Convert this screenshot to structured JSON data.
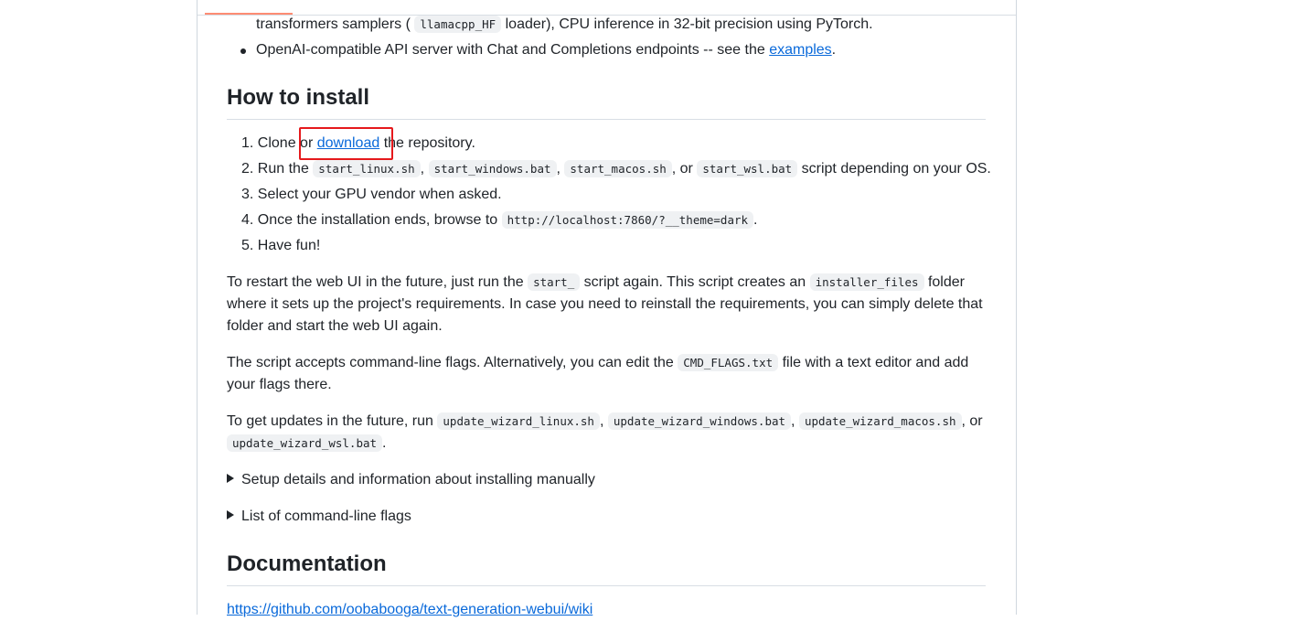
{
  "readme": {
    "features_tail": {
      "line1_a": "transformers samplers (",
      "line1_code": "llamacpp_HF",
      "line1_b": "loader), CPU inference in 32-bit precision using PyTorch.",
      "bullet_a": "OpenAI-compatible API server with Chat and Completions endpoints -- see the",
      "bullet_link": "examples",
      "bullet_b": "."
    },
    "install": {
      "heading": "How to install",
      "steps": [
        {
          "num": "1.",
          "a": "Clone or",
          "link": "download",
          "b": "the repository."
        },
        {
          "num": "2.",
          "a": "Run the",
          "code1": "start_linux.sh",
          "sep1": ",",
          "code2": "start_windows.bat",
          "sep2": ",",
          "code3": "start_macos.sh",
          "sep3": ", or",
          "code4": "start_wsl.bat",
          "b": "script depending on your OS."
        },
        {
          "num": "3.",
          "a": "Select your GPU vendor when asked."
        },
        {
          "num": "4.",
          "a": "Once the installation ends, browse to",
          "code1": "http://localhost:7860/?__theme=dark",
          "b": "."
        },
        {
          "num": "5.",
          "a": "Have fun!"
        }
      ],
      "restart": {
        "a": "To restart the web UI in the future, just run the",
        "code1": "start_",
        "b": "script again. This script creates an",
        "code2": "installer_files",
        "c": "folder where it sets up the project's requirements. In case you need to reinstall the requirements, you can simply delete that folder and start the web UI again."
      },
      "flags": {
        "a": "The script accepts command-line flags. Alternatively, you can edit the",
        "code1": "CMD_FLAGS.txt",
        "b": "file with a text editor and add your flags there."
      },
      "updates": {
        "a": "To get updates in the future, run",
        "code1": "update_wizard_linux.sh",
        "sep1": ",",
        "code2": "update_wizard_windows.bat",
        "sep2": ",",
        "code3": "update_wizard_macos.sh",
        "sep3": ", or",
        "code4": "update_wizard_wsl.bat",
        "b": "."
      },
      "details": [
        "Setup details and information about installing manually",
        "List of command-line flags"
      ]
    },
    "documentation": {
      "heading": "Documentation",
      "link": "https://github.com/oobabooga/text-generation-webui/wiki"
    }
  },
  "colors": {
    "link": "#0969da",
    "highlight_box": "#e5191c",
    "tab_indicator": "#fd8c73"
  }
}
